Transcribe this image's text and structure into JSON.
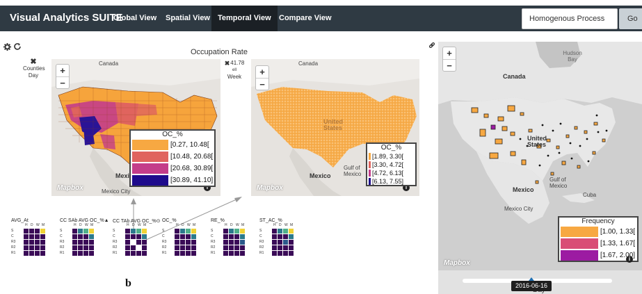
{
  "navbar": {
    "brand": "Visual Analytics SUITE",
    "items": [
      {
        "label": "Global View"
      },
      {
        "label": "Spatial View"
      },
      {
        "label": "Temporal View"
      },
      {
        "label": "Compare View"
      }
    ],
    "active_item": "Temporal View",
    "search": {
      "value": "Homogenous Process"
    },
    "go_label": "Go"
  },
  "colors": {
    "navbar_bg": "#2f3a43",
    "active_tab_bg": "#1b2025",
    "class1": "#f7a842",
    "class2": "#e0645e",
    "class3": "#c43d8a",
    "class4": "#1e0b8c",
    "freq1": "#f7a842",
    "freq2": "#d94e76",
    "freq3": "#9c1ba2"
  },
  "toolbar": {
    "settings_icon": "gear-icon",
    "refresh_icon": "refresh-icon",
    "link_icon": "link-icon"
  },
  "left_panel": {
    "title": "Occupation Rate",
    "side_left": {
      "icon": "close-icon",
      "line1": "Counties",
      "line2": "Day"
    },
    "side_right": {
      "icon": "close-icon",
      "line1": "41.78",
      "line2": "ell",
      "line3": "Week"
    }
  },
  "map1": {
    "labels": {
      "canada": "Canada",
      "mexico": "Mexico",
      "mexico_city": "Mexico City"
    },
    "zoom_in": "+",
    "zoom_out": "−",
    "logo": "Mapbox",
    "legend": {
      "title": "OC_%",
      "items": [
        "[0.27, 10.48[",
        "[10.48, 20.68[",
        "[20.68, 30.89[",
        "[30.89, 41.10]"
      ]
    }
  },
  "map2": {
    "labels": {
      "canada": "Canada",
      "united_states": "United States",
      "mexico": "Mexico",
      "gulf": "Gulf of Mexico"
    },
    "zoom_in": "+",
    "zoom_out": "−",
    "logo": "Mapbox",
    "legend": {
      "title": "OC_%",
      "items": [
        "[1.89, 3.30[",
        "[3.30, 4.72[",
        "[4.72, 6.13[",
        "[6.13, 7.55]"
      ]
    }
  },
  "map3": {
    "labels": {
      "hudson_bay": "Hudson Bay",
      "canada": "Canada",
      "united_states": "United States",
      "mexico": "Mexico",
      "mexico_city": "Mexico City",
      "cuba": "Cuba",
      "gulf": "Gulf of Mexico"
    },
    "zoom_in": "+",
    "zoom_out": "−",
    "logo": "Mapbox",
    "legend": {
      "title": "Frequency",
      "items": [
        "[1.00, 1.33[",
        "[1.33, 1.67[",
        "[1.67, 2.00]"
      ]
    }
  },
  "small_multiples": {
    "cols": [
      "H",
      "D",
      "W",
      "M"
    ],
    "rows": [
      "S",
      "C",
      "R3",
      "R2",
      "R1"
    ],
    "items": [
      {
        "label": "AVG_At"
      },
      {
        "label": "CC SAb AVG OC_%▲"
      },
      {
        "label": "CC TAb AVG OC_%⊙"
      },
      {
        "label": "OC_%"
      },
      {
        "label": "RE_%"
      },
      {
        "label": "ST_AC_%"
      }
    ],
    "annotation": "b"
  },
  "timeline": {
    "date": "2016-06-16",
    "unit_label": "Day",
    "position": 0.46
  }
}
